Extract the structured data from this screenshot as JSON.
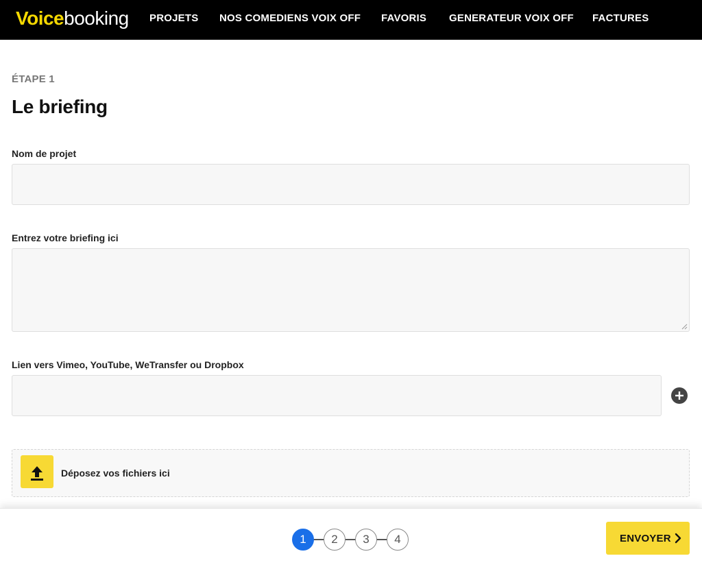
{
  "brand": {
    "part1": "Voice",
    "part2": "booking"
  },
  "nav": {
    "items": [
      {
        "label": "PROJETS"
      },
      {
        "label": "NOS COMEDIENS VOIX OFF"
      },
      {
        "label": "FAVORIS"
      },
      {
        "label": "GENERATEUR VOIX OFF"
      },
      {
        "label": "FACTURES"
      }
    ]
  },
  "page": {
    "step_label": "ÉTAPE 1",
    "title": "Le briefing"
  },
  "form": {
    "project_name": {
      "label": "Nom de projet",
      "value": "",
      "placeholder": ""
    },
    "briefing": {
      "label": "Entrez votre briefing ici",
      "value": "",
      "placeholder": ""
    },
    "link": {
      "label": "Lien vers Vimeo, YouTube, WeTransfer ou Dropbox",
      "value": "",
      "placeholder": ""
    },
    "dropzone": {
      "text": "Déposez vos fichiers ici"
    }
  },
  "footer": {
    "steps": [
      "1",
      "2",
      "3",
      "4"
    ],
    "current_step": 1,
    "send_label": "ENVOYER"
  },
  "colors": {
    "brand_yellow": "#f7d934",
    "active_step_blue": "#1a6fe8",
    "topbar": "#000000"
  },
  "icons": {
    "add_link": "plus-circle-icon",
    "upload": "upload-arrow-icon",
    "send": "chevron-right-icon"
  }
}
